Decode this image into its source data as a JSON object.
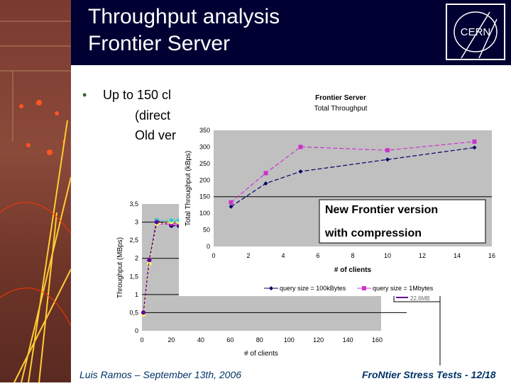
{
  "slide": {
    "title_line1": "Throughput analysis",
    "title_line2": "Frontier Server",
    "bullets": [
      "Up to 150 cl",
      "(direct",
      "Old ver"
    ],
    "footer_left": "Luis Ramos – September 13th, 2006",
    "footer_right": "FroNtier Stress Tests - 12/18",
    "logo_text": "CERN",
    "header_color": "#000033"
  },
  "chart_data": [
    {
      "type": "line",
      "title": "",
      "xlabel": "# of clients",
      "ylabel": "Throughput (MBps)",
      "xlim": [
        0,
        180
      ],
      "ylim": [
        0,
        3.5
      ],
      "xticks": [
        "0",
        "20",
        "40",
        "60",
        "80",
        "100",
        "120",
        "140",
        "160"
      ],
      "yticks": [
        "0",
        "0,5",
        "1",
        "1,5",
        "2",
        "2,5",
        "3",
        "3,5"
      ],
      "legend": [
        "22,6MB"
      ],
      "legend_placement": "right",
      "note": "partially hidden behind the overlaid chart",
      "series": [
        {
          "color": "#000066",
          "x": [
            1,
            5,
            10,
            20,
            25
          ],
          "y": [
            0.5,
            1.95,
            3.05,
            2.9,
            2.9
          ]
        },
        {
          "color": "#cc00cc",
          "x": [
            1,
            5,
            10,
            20,
            25
          ],
          "y": [
            0.5,
            1.95,
            2.95,
            2.95,
            2.95
          ]
        },
        {
          "color": "#ffff66",
          "x": [
            1,
            5,
            10,
            20,
            25
          ],
          "y": [
            0.45,
            1.85,
            2.95,
            3.0,
            3.0
          ]
        },
        {
          "color": "#33cccc",
          "x": [
            10,
            20,
            25
          ],
          "y": [
            3.05,
            3.05,
            3.05
          ]
        },
        {
          "color": "#660099",
          "x": [
            1,
            5,
            10
          ],
          "y": [
            0.5,
            1.95,
            3.0
          ]
        }
      ]
    },
    {
      "type": "line",
      "title": "Frontier Server",
      "subtitle": "Total Throughput",
      "xlabel": "# of clients",
      "ylabel": "Total Throughput (kBps)",
      "xlim": [
        0,
        16
      ],
      "ylim": [
        0,
        350
      ],
      "xticks": [
        "0",
        "2",
        "4",
        "6",
        "8",
        "10",
        "12",
        "14",
        "16"
      ],
      "yticks": [
        "0",
        "50",
        "100",
        "150",
        "200",
        "250",
        "300",
        "350"
      ],
      "legend_placement": "bottom",
      "annotation": [
        "New Frontier version",
        "with compression"
      ],
      "series": [
        {
          "name": "query size = 100kBytes",
          "color": "#000066",
          "marker": "diamond",
          "x": [
            1,
            3,
            5,
            10,
            15
          ],
          "y": [
            120,
            190,
            226,
            262,
            298
          ]
        },
        {
          "name": "query size = 1Mbytes",
          "color": "#cc33cc",
          "marker": "square",
          "x": [
            1,
            3,
            5,
            10,
            15
          ],
          "y": [
            133,
            221,
            300,
            290,
            316
          ]
        }
      ]
    }
  ]
}
